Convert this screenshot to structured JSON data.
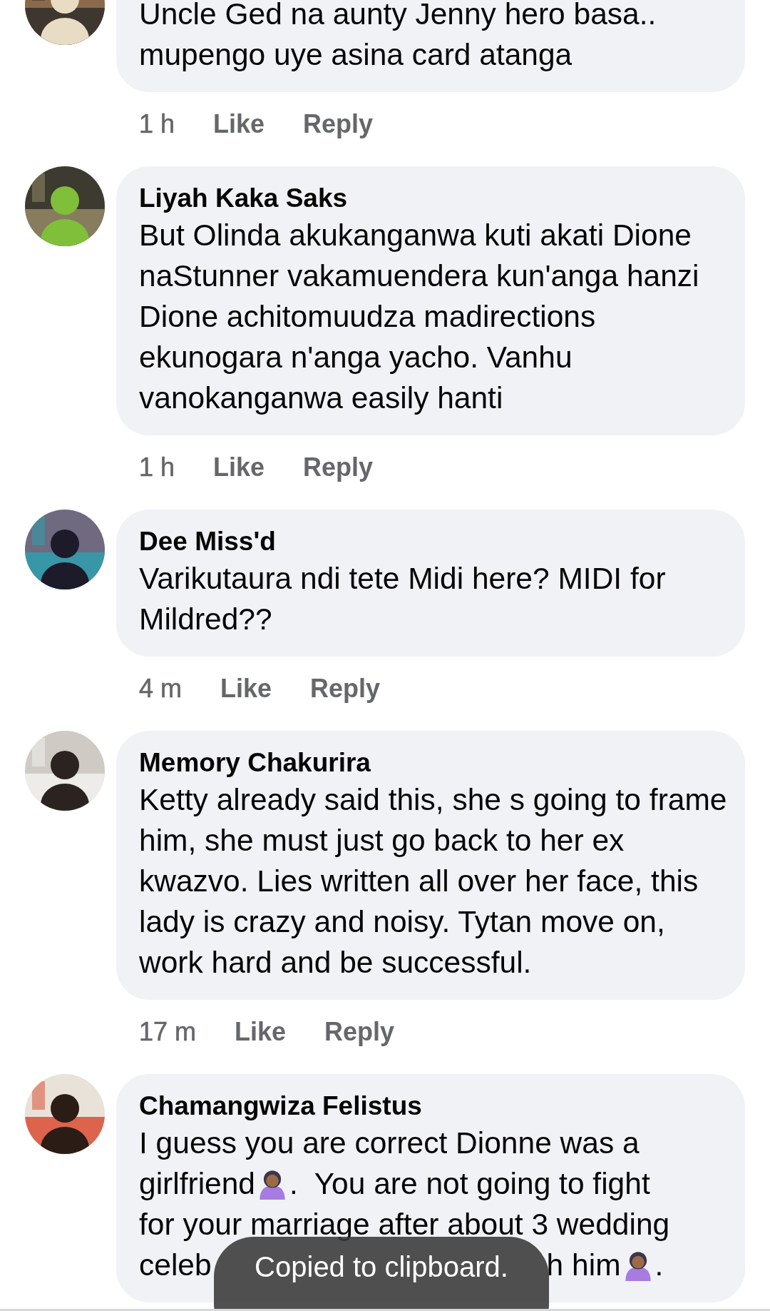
{
  "comments": [
    {
      "body": [
        {
          "kind": "text",
          "text": "Uncle Ged na aunty Jenny hero basa.. mupengo uye asina card atanga"
        }
      ],
      "time": "1 h",
      "like": "Like",
      "reply": "Reply"
    },
    {
      "name": "Liyah Kaka Saks",
      "body": [
        {
          "kind": "text",
          "text": "But Olinda akukanganwa kuti akati Dione naStunner vakamuendera kun'anga hanzi Dione achitomuudza madirections ekunogara n'anga yacho. Vanhu vanokanganwa easily hanti"
        }
      ],
      "time": "1 h",
      "like": "Like",
      "reply": "Reply"
    },
    {
      "name": "Dee Miss'd",
      "body": [
        {
          "kind": "text",
          "text": "Varikutaura ndi tete Midi here? MIDI for Mildred??"
        }
      ],
      "time": "4 m",
      "like": "Like",
      "reply": "Reply"
    },
    {
      "name": "Memory Chakurira",
      "body": [
        {
          "kind": "text",
          "text": "Ketty already said this, she s going to frame him, she must just go back to her ex kwazvo. Lies written all over her face, this lady is crazy and noisy. Tytan move on, work hard and be successful."
        }
      ],
      "time": "17 m",
      "like": "Like",
      "reply": "Reply"
    },
    {
      "name": "Chamangwiza Felistus",
      "lines": [
        [
          {
            "kind": "text",
            "text": "I guess you are correct Dionne was a"
          }
        ],
        [
          {
            "kind": "text",
            "text": "girlfriend"
          },
          {
            "kind": "emoji"
          },
          {
            "kind": "text",
            "text": ".  You are not going to fight"
          }
        ],
        [
          {
            "kind": "text",
            "text": "for your marriage after about 3 wedding"
          }
        ],
        [
          {
            "kind": "text",
            "text": "celeb"
          },
          {
            "kind": "gap"
          },
          {
            "kind": "text",
            "text": "h him"
          },
          {
            "kind": "emoji"
          },
          {
            "kind": "text",
            "text": "."
          }
        ]
      ]
    }
  ],
  "toast": "Copied to clipboard."
}
